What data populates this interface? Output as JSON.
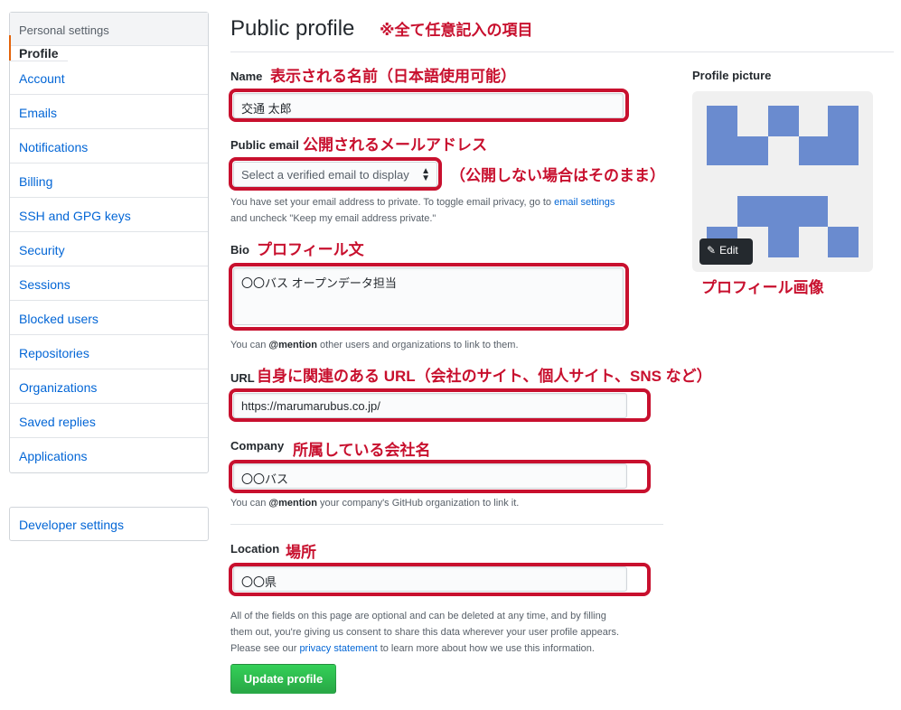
{
  "sidebar": {
    "header": "Personal settings",
    "items": [
      {
        "label": "Profile",
        "active": true
      },
      {
        "label": "Account"
      },
      {
        "label": "Emails"
      },
      {
        "label": "Notifications"
      },
      {
        "label": "Billing"
      },
      {
        "label": "SSH and GPG keys"
      },
      {
        "label": "Security"
      },
      {
        "label": "Sessions"
      },
      {
        "label": "Blocked users"
      },
      {
        "label": "Repositories"
      },
      {
        "label": "Organizations"
      },
      {
        "label": "Saved replies"
      },
      {
        "label": "Applications"
      }
    ],
    "developer": "Developer settings"
  },
  "main": {
    "title": "Public profile",
    "title_annotation": "※全て任意記入の項目",
    "name": {
      "label": "Name",
      "annotation": "表示される名前（日本語使用可能）",
      "value": "交通 太郎"
    },
    "email": {
      "label": "Public email",
      "annotation": "公開されるメールアドレス",
      "placeholder": "Select a verified email to display",
      "side_annotation": "（公開しない場合はそのまま）",
      "note_1": "You have set your email address to private. To toggle email privacy, go to ",
      "note_link": "email settings",
      "note_2": "and uncheck \"Keep my email address private.\""
    },
    "bio": {
      "label": "Bio",
      "annotation": "プロフィール文",
      "value": "〇〇バス オープンデータ担当",
      "note_1": "You can ",
      "note_mention": "@mention",
      "note_2": " other users and organizations to link to them."
    },
    "url": {
      "label": "URL",
      "annotation": "自身に関連のある URL（会社のサイト、個人サイト、SNS など）",
      "value": "https://marumarubus.co.jp/"
    },
    "company": {
      "label": "Company",
      "annotation": "所属している会社名",
      "value": "〇〇バス",
      "note_1": "You can ",
      "note_mention": "@mention",
      "note_2": " your company's GitHub organization to link it."
    },
    "location": {
      "label": "Location",
      "annotation": "場所",
      "value": "〇〇県"
    },
    "footer_1": "All of the fields on this page are optional and can be deleted at any time, and by filling",
    "footer_2": "them out, you're giving us consent to share this data wherever your user profile appears.",
    "footer_3a": "Please see our ",
    "footer_link": "privacy statement",
    "footer_3b": " to learn more about how we use this information.",
    "update_button": "Update profile"
  },
  "profile_picture": {
    "label": "Profile picture",
    "edit_label": "Edit",
    "annotation": "プロフィール画像",
    "identicon_color": "#6a8bcf"
  },
  "colors": {
    "accent": "#0366d6",
    "annotation_red": "#c8102e",
    "button_green": "#2ea44f"
  }
}
